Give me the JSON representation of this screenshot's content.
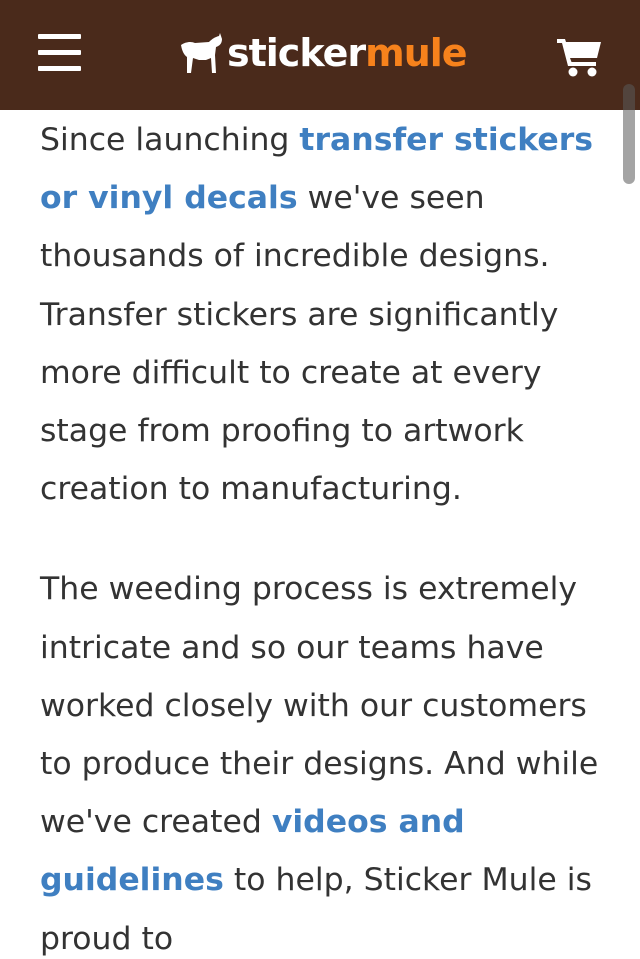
{
  "header": {
    "logo": {
      "part1": "sticker",
      "part2": "mule",
      "icon": "mule-icon"
    },
    "menu_icon": "hamburger-menu-icon",
    "cart_icon": "shopping-cart-icon"
  },
  "colors": {
    "header_bg": "#4a2a1b",
    "logo_accent": "#f7821c",
    "link": "#3f7fc1",
    "body_text": "#333333"
  },
  "article": {
    "p1": {
      "before": "Since launching ",
      "link": "transfer stickers or vinyl decals",
      "after": " we've seen thousands of incredible designs. Transfer stickers are significantly more difficult to create at every stage from proofing to artwork creation to manufacturing."
    },
    "p2": {
      "before": "The weeding process is extremely intricate and so our teams have worked closely with our customers to produce their designs. And while we've created ",
      "link": "videos and guidelines",
      "after": " to help, Sticker Mule is proud to"
    }
  }
}
